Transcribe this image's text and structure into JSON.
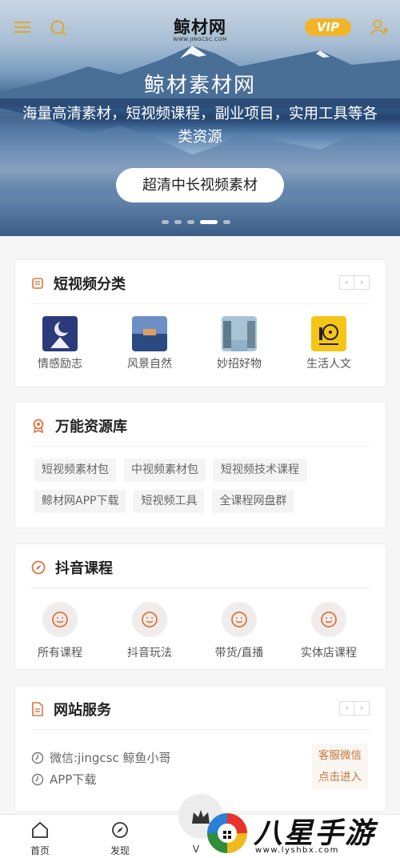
{
  "header": {
    "logo_text": "鲸材网",
    "logo_domain": "WWW.JINGCSC.COM",
    "vip_label": "VIP",
    "icons": [
      "menu-icon",
      "search-icon",
      "user-vip-icon"
    ]
  },
  "banner": {
    "title": "鲸材素材网",
    "subtitle": "海量高清素材，短视频课程，副业项目，实用工具等各类资源",
    "cta": "超清中长视频素材",
    "slide_count": 5,
    "active_slide": 4
  },
  "short_video": {
    "title": "短视频分类",
    "prev": "‹",
    "next": "›",
    "items": [
      {
        "label": "情感励志"
      },
      {
        "label": "风景自然"
      },
      {
        "label": "妙招好物"
      },
      {
        "label": "生活人文"
      }
    ]
  },
  "resources": {
    "title": "万能资源库",
    "tags": [
      "短视频素材包",
      "中视频素材包",
      "短视频技术课程",
      "鲸材网APP下载",
      "短视频工具",
      "全课程网盘群"
    ]
  },
  "douyin": {
    "title": "抖音课程",
    "items": [
      {
        "label": "所有课程"
      },
      {
        "label": "抖音玩法"
      },
      {
        "label": "带货/直播"
      },
      {
        "label": "实体店课程"
      }
    ]
  },
  "services": {
    "title": "网站服务",
    "prev": "‹",
    "next": "›",
    "lines": [
      "微信:jingcsc 鲸鱼小哥",
      "APP下载"
    ],
    "button_line1": "客服微信",
    "button_line2": "点击进入"
  },
  "bottom_nav": {
    "items": [
      {
        "label": "首页"
      },
      {
        "label": "发现"
      },
      {
        "label": "V"
      }
    ]
  },
  "watermark": {
    "text": "八星手游网",
    "url": "www.lyshbx.com"
  },
  "colors": {
    "accent": "#f2b52a",
    "icon_orange": "#d9773f",
    "service_text": "#c8743b"
  }
}
